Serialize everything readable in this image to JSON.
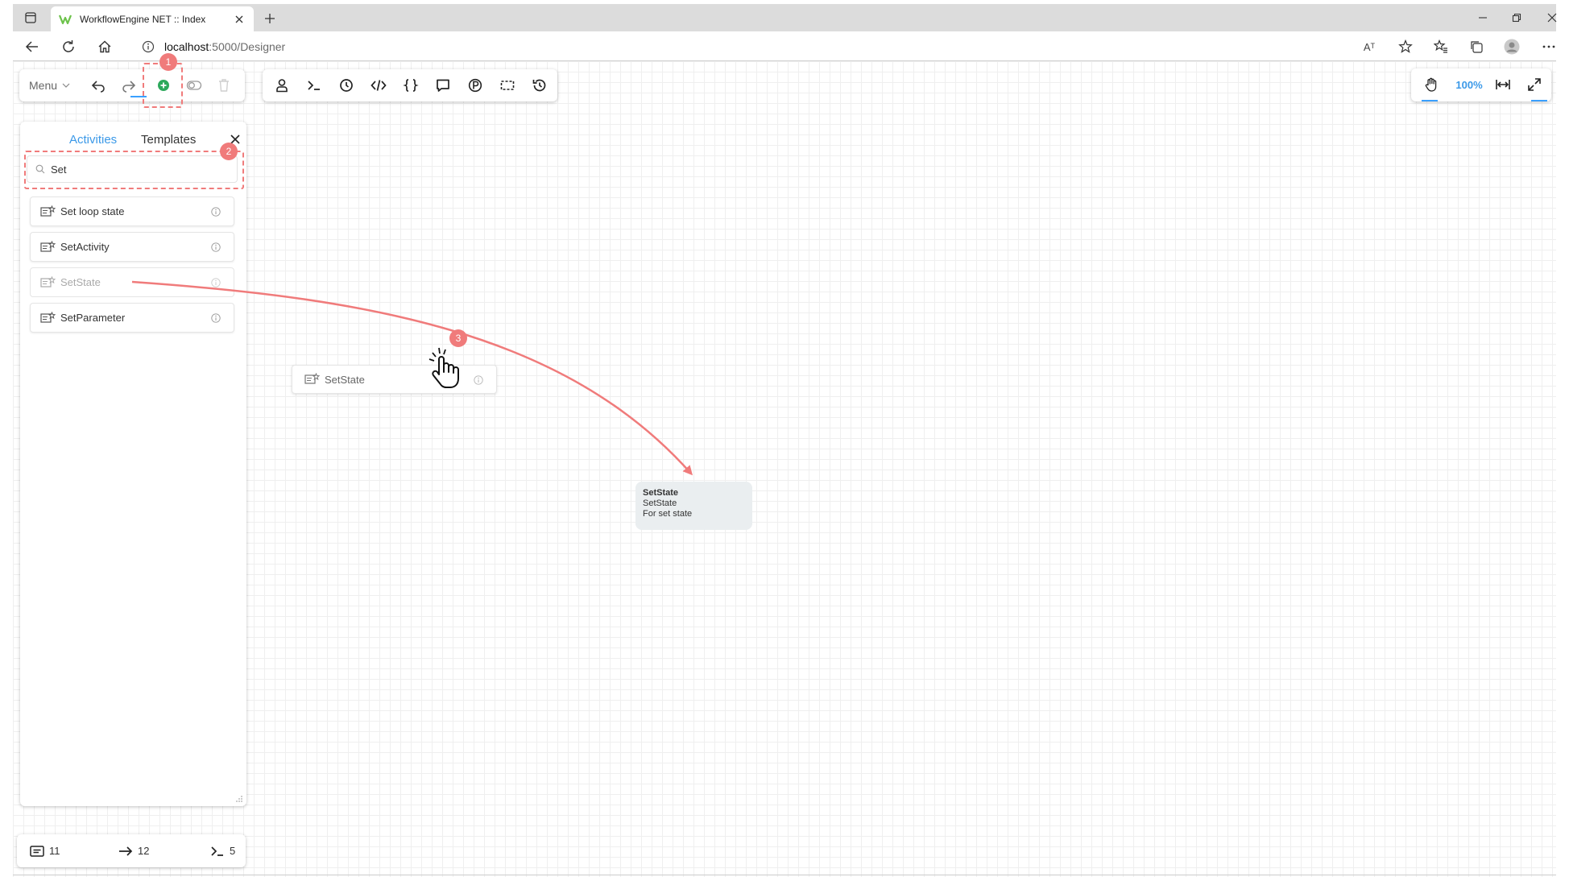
{
  "browser": {
    "tab_title": "WorkflowEngine NET :: Index",
    "url_host": "localhost",
    "url_path": ":5000/Designer",
    "read_aloud_label": "Aᵀ"
  },
  "toolbar": {
    "menu_label": "Menu",
    "left_icons": [
      "undo-icon",
      "redo-icon",
      "add-activity-icon",
      "toggle-icon",
      "delete-icon"
    ],
    "element_icons": [
      "actor-icon",
      "command-icon",
      "timer-icon",
      "code-icon",
      "json-icon",
      "comment-icon",
      "parameter-icon",
      "selection-icon",
      "history-icon"
    ]
  },
  "sidepanel": {
    "tabs": [
      "Activities",
      "Templates"
    ],
    "active_tab": "Activities",
    "search_value": "Set",
    "activities": [
      {
        "label": "Set loop state"
      },
      {
        "label": "SetActivity"
      },
      {
        "label": "SetState"
      },
      {
        "label": "SetParameter"
      }
    ]
  },
  "drag_ghost": {
    "label": "SetState"
  },
  "node": {
    "title": "SetState",
    "type": "SetState",
    "description": "For set state"
  },
  "stats": {
    "activities_count": "11",
    "transitions_count": "12",
    "commands_count": "5"
  },
  "zoom": {
    "level": "100%"
  },
  "annotations": {
    "badge_1": "1",
    "badge_2": "2",
    "badge_3": "3",
    "color": "#f07b7b"
  }
}
